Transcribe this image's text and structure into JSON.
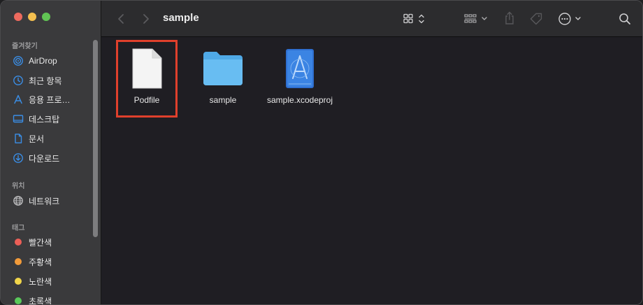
{
  "window": {
    "title": "sample"
  },
  "sidebar": {
    "sections": {
      "favorites": "즐겨찾기",
      "locations": "위치",
      "tags": "태그"
    },
    "favorites": [
      {
        "label": "AirDrop",
        "icon": "airdrop-icon"
      },
      {
        "label": "최근 항목",
        "icon": "recents-clock-icon"
      },
      {
        "label": "응용 프로…",
        "icon": "applications-icon"
      },
      {
        "label": "데스크탑",
        "icon": "desktop-icon"
      },
      {
        "label": "문서",
        "icon": "document-icon"
      },
      {
        "label": "다운로드",
        "icon": "downloads-icon"
      }
    ],
    "locations": [
      {
        "label": "네트워크",
        "icon": "network-globe-icon"
      }
    ],
    "tags": [
      {
        "label": "빨간색",
        "color": "#ec5f57"
      },
      {
        "label": "주황색",
        "color": "#f29b3a"
      },
      {
        "label": "노란색",
        "color": "#f1d54a"
      },
      {
        "label": "초록색",
        "color": "#5ac95a"
      }
    ],
    "accent": "#3a8ee6"
  },
  "toolbar": {
    "back": "chevron-left-icon",
    "forward": "chevron-right-icon",
    "view": "grid-view-icon",
    "group": "group-icon",
    "share": "share-icon",
    "tag": "tag-icon",
    "more": "ellipsis-circle-icon",
    "search": "search-icon"
  },
  "files": [
    {
      "name": "Podfile",
      "kind": "document",
      "selected": true
    },
    {
      "name": "sample",
      "kind": "folder",
      "selected": false
    },
    {
      "name": "sample.xcodeproj",
      "kind": "xcodeproj",
      "selected": false
    }
  ]
}
